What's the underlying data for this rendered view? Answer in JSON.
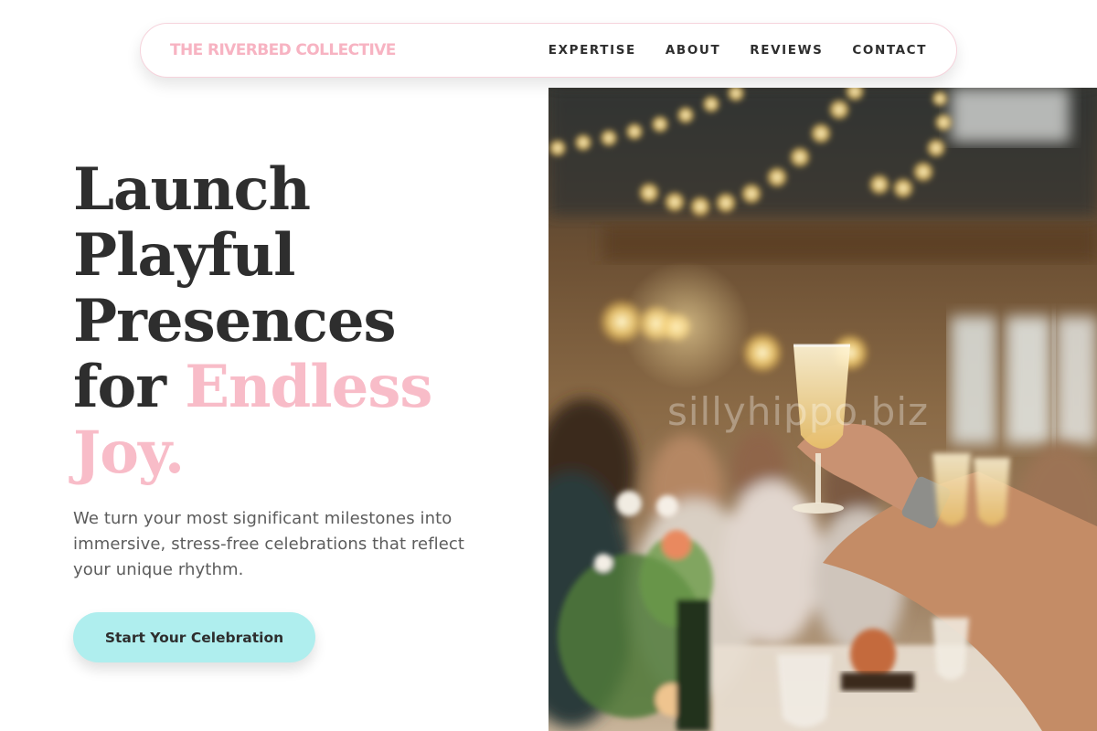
{
  "nav": {
    "brand": "THE RIVERBED COLLECTIVE",
    "links": [
      "EXPERTISE",
      "ABOUT",
      "REVIEWS",
      "CONTACT"
    ]
  },
  "hero": {
    "heading_lines": [
      "Launch",
      "Playful",
      "Presences"
    ],
    "heading_last_prefix": "for ",
    "heading_accent_1": "Endless",
    "heading_accent_2": "Joy.",
    "subtext": "We turn your most significant milestones into immersive, stress-free celebrations that reflect your unique rhythm.",
    "cta_label": "Start Your Celebration"
  },
  "image": {
    "watermark": "sillyhippo.biz"
  },
  "colors": {
    "accent_pink": "#f8bcc8",
    "brand_pink": "#f7b3c2",
    "cta_aqua": "#afeeee",
    "text_dark": "#2e2e2e",
    "text_muted": "#5c5c5c"
  }
}
